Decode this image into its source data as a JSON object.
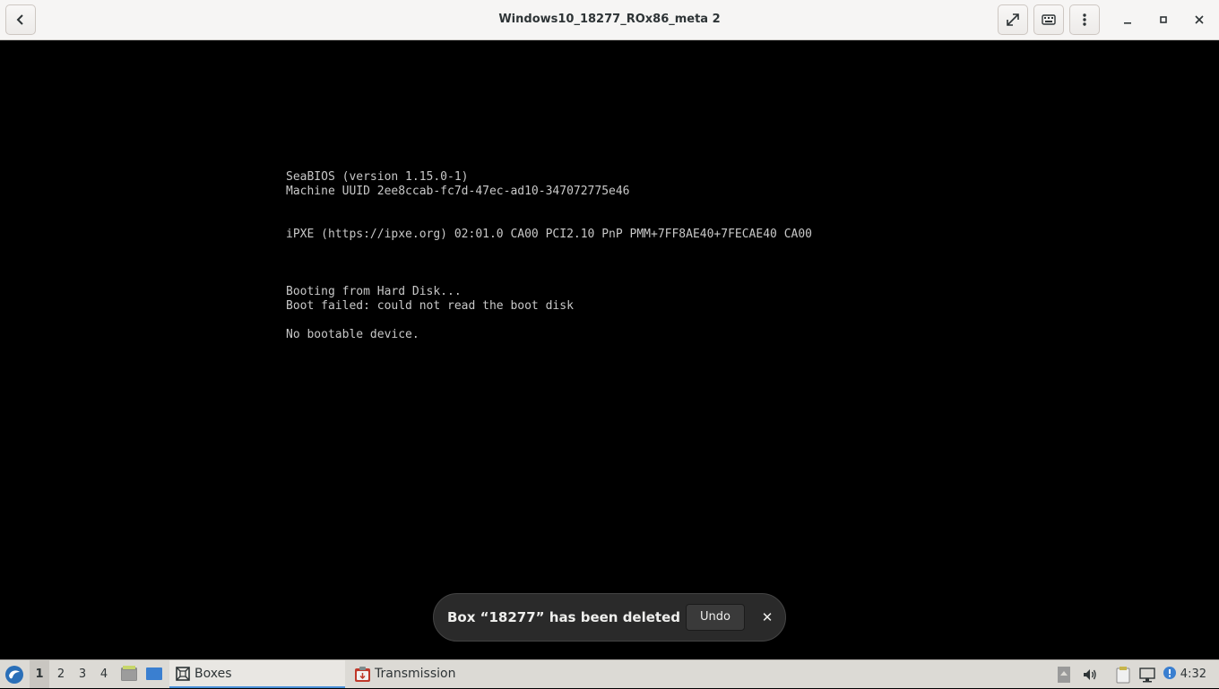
{
  "window": {
    "title": "Windows10_18277_ROx86_meta 2"
  },
  "console": {
    "lines": [
      "SeaBIOS (version 1.15.0-1)",
      "Machine UUID 2ee8ccab-fc7d-47ec-ad10-347072775e46",
      "iPXE (https://ipxe.org) 02:01.0 CA00 PCI2.10 PnP PMM+7FF8AE40+7FECAE40 CA00",
      "Booting from Hard Disk...",
      "Boot failed: could not read the boot disk",
      "No bootable device."
    ]
  },
  "toast": {
    "message": "Box “18277” has been deleted",
    "undo_label": "Undo",
    "close_glyph": "✕"
  },
  "taskbar": {
    "workspaces": [
      "1",
      "2",
      "3",
      "4"
    ],
    "tasks": [
      {
        "label": "Boxes",
        "icon": "boxes-icon"
      },
      {
        "label": "Transmission",
        "icon": "transmission-icon"
      }
    ],
    "clock": "4:32"
  },
  "colors": {
    "accent": "#4a90d9",
    "console_text": "#c8c8c8",
    "headerbar_bg": "#f6f5f4"
  }
}
